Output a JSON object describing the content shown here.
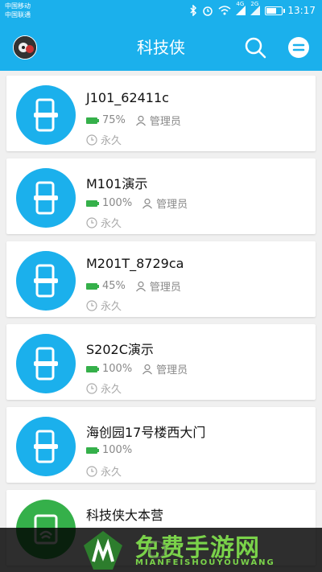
{
  "status_bar": {
    "carrier_1": "中国移动",
    "carrier_2": "中国联通",
    "net_1": "4G",
    "net_2": "2G",
    "time": "13:17"
  },
  "app_bar": {
    "title": "科技侠"
  },
  "locks": [
    {
      "name": "J101_62411c",
      "battery": "75%",
      "role": "管理员",
      "validity": "永久"
    },
    {
      "name": "M101演示",
      "battery": "100%",
      "role": "管理员",
      "validity": "永久"
    },
    {
      "name": "M201T_8729ca",
      "battery": "45%",
      "role": "管理员",
      "validity": "永久"
    },
    {
      "name": "S202C演示",
      "battery": "100%",
      "role": "管理员",
      "validity": "永久"
    },
    {
      "name": "海创园17号楼西大门",
      "battery": "100%",
      "validity": "永久"
    },
    {
      "name": "科技侠大本营"
    }
  ],
  "watermark": {
    "text": "免费手游网",
    "sub": "MIANFEISHOUYOUWANG"
  },
  "colors": {
    "accent": "#1bb0ec",
    "battery": "#35b04a",
    "gateway": "#35b04a"
  }
}
